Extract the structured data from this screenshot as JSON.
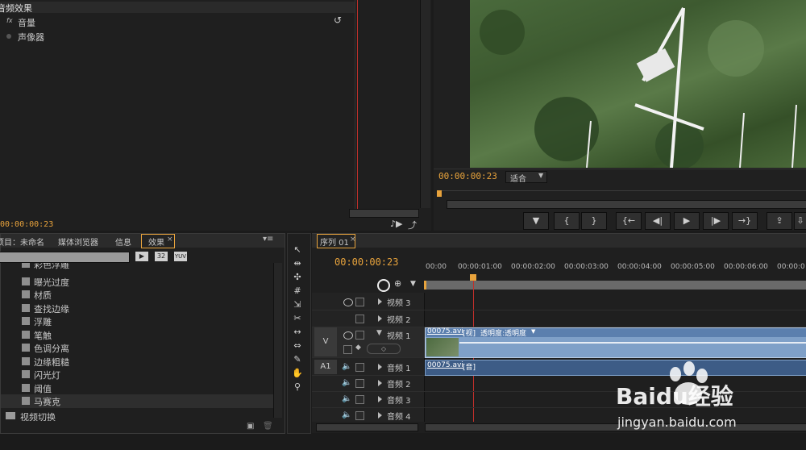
{
  "effect_controls": {
    "section_title": "音频效果",
    "items": [
      {
        "prefix": "fx",
        "label": "音量"
      },
      {
        "prefix": "",
        "label": "声像器"
      }
    ],
    "timecode": "00:00:00:23",
    "reset_icon": "reset-icon"
  },
  "program_monitor": {
    "timecode": "00:00:00:23",
    "fit_select": "适合",
    "buttons": [
      {
        "name": "add-marker-button",
        "glyph": "▼"
      },
      {
        "name": "mark-in-button",
        "glyph": "{"
      },
      {
        "name": "mark-out-button",
        "glyph": "}"
      },
      {
        "name": "go-to-in-button",
        "glyph": "{←"
      },
      {
        "name": "step-back-button",
        "glyph": "◀|"
      },
      {
        "name": "play-button",
        "glyph": "▶"
      },
      {
        "name": "step-forward-button",
        "glyph": "|▶"
      },
      {
        "name": "go-to-out-button",
        "glyph": "→}"
      },
      {
        "name": "lift-button",
        "glyph": "⇪"
      },
      {
        "name": "extract-button",
        "glyph": "⇩"
      }
    ]
  },
  "project_panel": {
    "tabs": [
      {
        "label": "项目：未命名"
      },
      {
        "label": "媒体浏览器"
      },
      {
        "label": "信息"
      },
      {
        "label": "效果"
      }
    ],
    "format_buttons": [
      "32",
      "YUV"
    ],
    "effects": [
      {
        "label": "彩色浮雕"
      },
      {
        "label": "曝光过度"
      },
      {
        "label": "材质"
      },
      {
        "label": "查找边缘"
      },
      {
        "label": "浮雕"
      },
      {
        "label": "笔触"
      },
      {
        "label": "色调分离"
      },
      {
        "label": "边缘粗糙"
      },
      {
        "label": "闪光灯"
      },
      {
        "label": "阈值"
      },
      {
        "label": "马赛克"
      }
    ],
    "folder": "视频切换"
  },
  "sequence": {
    "tab_label": "序列 01",
    "timecode": "00:00:00:23",
    "ruler_ticks": [
      "00:00",
      "00:00:01:00",
      "00:00:02:00",
      "00:00:03:00",
      "00:00:04:00",
      "00:00:05:00",
      "00:00:06:00",
      "00:00:0"
    ],
    "playhead_fraction": 0.0958,
    "video_tracks": [
      {
        "label": "视频 3"
      },
      {
        "label": "视频 2"
      },
      {
        "label": "视频 1",
        "source": "V"
      }
    ],
    "audio_tracks": [
      {
        "label": "音频 1",
        "source": "A1"
      },
      {
        "label": "音频 2"
      },
      {
        "label": "音频 3"
      },
      {
        "label": "音频 4"
      }
    ],
    "video_clip": {
      "name": "00075.avi",
      "tag": "[视]",
      "effect": "透明度:透明度"
    },
    "audio_clip": {
      "name": "00075.avi",
      "tag": "[音]"
    }
  },
  "watermark": {
    "brand": "Baidu经验",
    "url": "jingyan.baidu.com"
  },
  "colors": {
    "accent": "#e8a33c",
    "playhead": "#c0302b",
    "clip_video": "#7fa0c8",
    "clip_audio": "#3d5c86"
  }
}
